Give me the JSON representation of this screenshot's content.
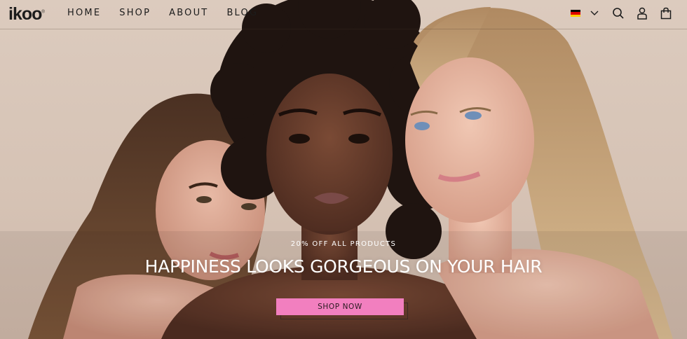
{
  "brand": {
    "name": "ikoo",
    "mark": "®"
  },
  "nav": {
    "items": [
      {
        "label": "HOME"
      },
      {
        "label": "SHOP"
      },
      {
        "label": "ABOUT"
      },
      {
        "label": "BLOG"
      }
    ]
  },
  "header_utils": {
    "language_flag": "germany-flag-icon",
    "icons": [
      "chevron-down-icon",
      "search-icon",
      "user-icon",
      "shopping-bag-icon"
    ]
  },
  "hero": {
    "eyebrow": "20% OFF ALL PRODUCTS",
    "headline": "HAPPINESS LOOKS GORGEOUS ON YOUR HAIR",
    "cta_label": "SHOP NOW"
  },
  "colors": {
    "background": "#d8c6b8",
    "cta": "#f27fbf",
    "text_dark": "#1c1c1c",
    "text_light": "#ffffff"
  }
}
